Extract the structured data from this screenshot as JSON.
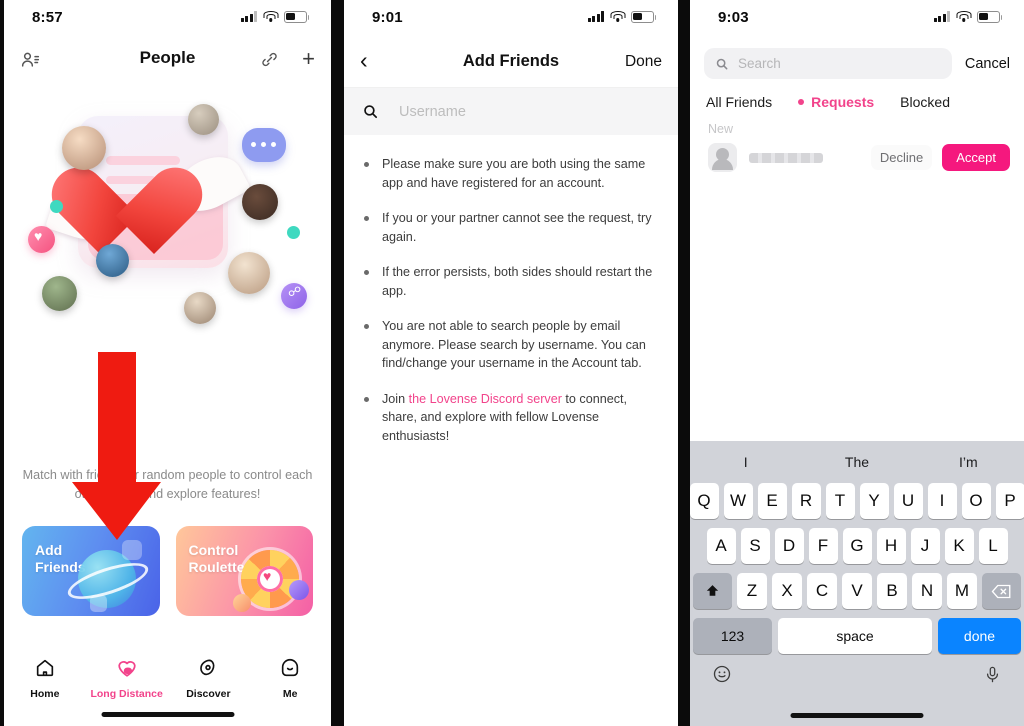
{
  "panel1": {
    "status": {
      "time": "8:57"
    },
    "header": {
      "title": "People",
      "left_icon": "person-add-icon",
      "link_icon": "link-icon",
      "plus_icon": "plus-icon",
      "plus_glyph": "+"
    },
    "description": "Match with friends or random people to control each other's toys and explore features!",
    "cards": [
      {
        "title": "Add\nFriends",
        "name": "add-friends-card"
      },
      {
        "title": "Control\nRoulette",
        "name": "control-roulette-card"
      }
    ],
    "tabbar": [
      {
        "label": "Home",
        "icon": "home-icon",
        "active": false
      },
      {
        "label": "Long Distance",
        "icon": "heart-icon",
        "active": true
      },
      {
        "label": "Discover",
        "icon": "compass-icon",
        "active": false
      },
      {
        "label": "Me",
        "icon": "face-icon",
        "active": false
      }
    ],
    "accent": "#f2438b",
    "arrow_color": "#ef1b11"
  },
  "panel2": {
    "status": {
      "time": "9:01"
    },
    "header": {
      "back_glyph": "‹",
      "title": "Add Friends",
      "done_label": "Done"
    },
    "search": {
      "placeholder": "Username",
      "icon": "search-icon"
    },
    "bullets": [
      {
        "text": "Please make sure you are both using the same app and have registered for an account."
      },
      {
        "text": "If you or your partner cannot see the request, try again."
      },
      {
        "text": "If the error persists, both sides should restart the app."
      },
      {
        "text": "You are not able to search people by email anymore. Please search by username. You can find/change your username in the Account tab."
      }
    ],
    "last_bullet": {
      "prefix": "Join ",
      "link": "the Lovense Discord server",
      "suffix": " to connect, share, and explore with fellow Lovense enthusiasts!"
    }
  },
  "panel3": {
    "status": {
      "time": "9:03"
    },
    "search": {
      "placeholder": "Search",
      "icon": "search-icon",
      "cancel_label": "Cancel"
    },
    "tabs": [
      {
        "label": "All Friends",
        "active": false
      },
      {
        "label": "Requests",
        "active": true
      },
      {
        "label": "Blocked",
        "active": false
      }
    ],
    "section_label": "New",
    "request": {
      "name_redacted": "",
      "decline_label": "Decline",
      "accept_label": "Accept"
    },
    "keyboard": {
      "suggestions": [
        "I",
        "The",
        "I’m"
      ],
      "row1": [
        "Q",
        "W",
        "E",
        "R",
        "T",
        "Y",
        "U",
        "I",
        "O",
        "P"
      ],
      "row2": [
        "A",
        "S",
        "D",
        "F",
        "G",
        "H",
        "J",
        "K",
        "L"
      ],
      "row3": [
        "Z",
        "X",
        "C",
        "V",
        "B",
        "N",
        "M"
      ],
      "shift_icon": "shift-icon",
      "backspace_icon": "backspace-icon",
      "num_label": "123",
      "space_label": "space",
      "done_label": "done",
      "emoji_icon": "emoji-icon",
      "mic_icon": "microphone-icon",
      "done_color": "#0a84ff"
    }
  }
}
